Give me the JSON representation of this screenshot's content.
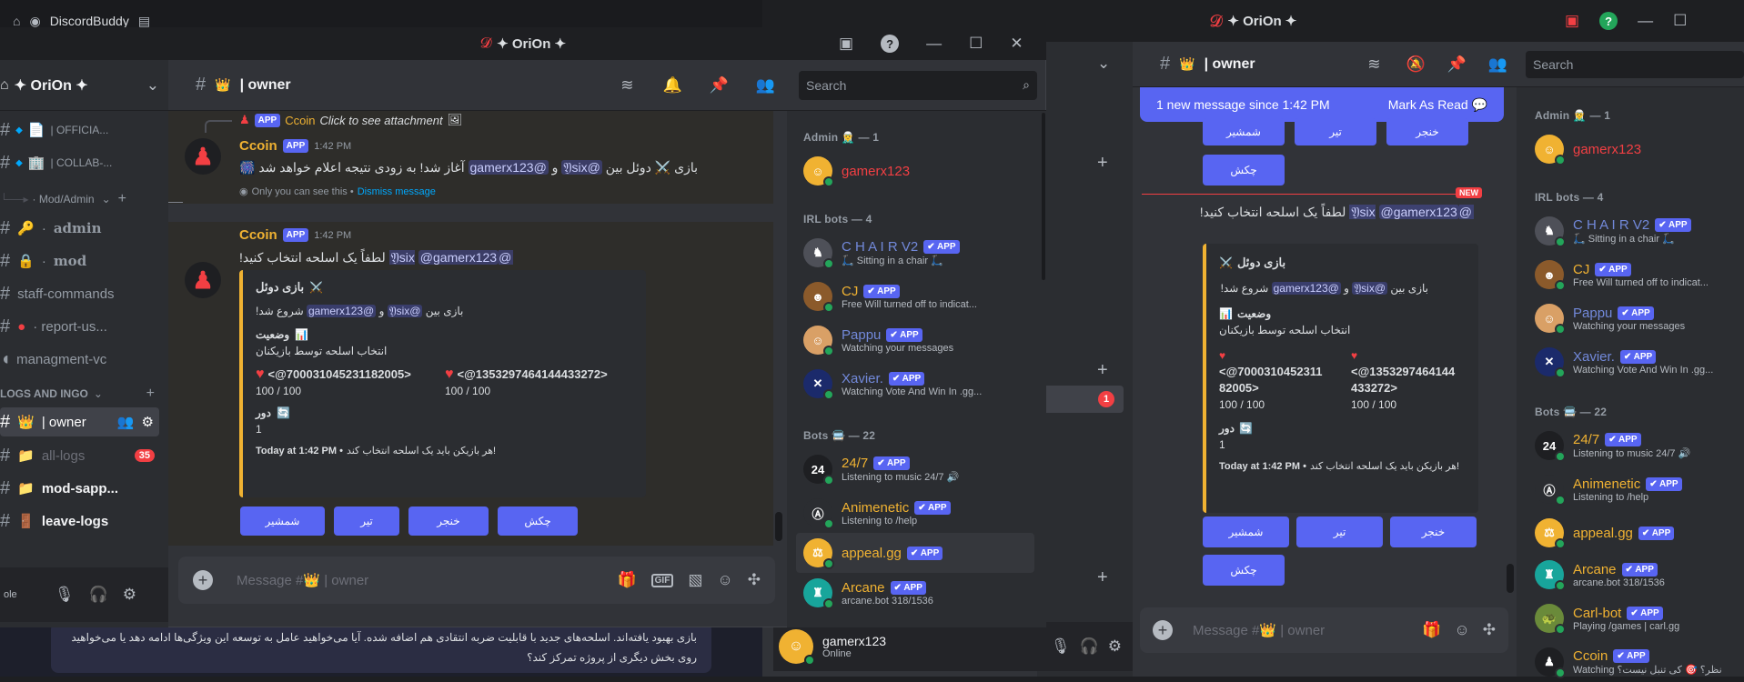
{
  "taskbar": {
    "app_name": "DiscordBuddy"
  },
  "main": {
    "title": "✦ OriOn ✦",
    "server_name": "✦ OriOn ✦",
    "channel_name": "| owner",
    "search_placeholder": "Search",
    "message_placeholder": "Message #",
    "message_placeholder_channel": "| owner",
    "channels": [
      {
        "label": "| OFFICIA..."
      },
      {
        "label": "| COLLAB-..."
      },
      {
        "label": "· Mod/Admin"
      },
      {
        "label": "admin"
      },
      {
        "label": "mod"
      },
      {
        "label": "staff-commands"
      },
      {
        "label": "· report-us..."
      },
      {
        "label": "managment-vc"
      },
      {
        "label": "LOGS AND INGO"
      },
      {
        "label": "| owner"
      },
      {
        "label": "all-logs",
        "badge": "35"
      },
      {
        "label": "mod-sapp..."
      },
      {
        "label": "leave-logs"
      }
    ],
    "user_status": "ole",
    "messages": {
      "reply_app": "APP",
      "reply_name": "Ccoin",
      "reply_text": "Click to see attachment",
      "m1_name": "Ccoin",
      "m1_badge": "APP",
      "m1_time": "1:42 PM",
      "m1_text_a": "بازی",
      "m1_text_b": "دوئل بین",
      "m1_mention_a": "@𝔜six",
      "m1_and": "و",
      "m1_mention_b": "@gamerx123",
      "m1_text_c": "آغاز شد! به زودی نتیجه اعلام خواهد شد",
      "m1_ephemeral": "Only you can see this •",
      "m1_dismiss": "Dismiss message",
      "m2_name": "Ccoin",
      "m2_badge": "APP",
      "m2_time": "1:42 PM",
      "m2_text": "لطفاً یک اسلحه انتخاب کنید!",
      "m2_mention_a": "@gamerx123",
      "m2_mention_b": "@𝔜six",
      "embed_title": "بازی دوئل",
      "embed_line1_a": "بازی بین",
      "embed_line1_b": "و",
      "embed_line1_c": "شروع شد!",
      "embed_mention_a": "@gamerx123",
      "embed_mention_b": "@𝔜six",
      "embed_status_title": "وضعیت",
      "embed_status_text": "انتخاب اسلحه توسط بازیکنان",
      "p1_id": "<@700031045231182005>",
      "p1_hp": "100 / 100",
      "p2_id": "<@1353297464144433272>",
      "p2_hp": "100 / 100",
      "round_title": "دور",
      "round_value": "1",
      "footer_time": "Today at 1:42 PM •",
      "footer_text": "هر بازیکن باید یک اسلحه انتخاب کند!"
    },
    "buttons": [
      "شمشیر",
      "تیر",
      "خنجر",
      "چکش"
    ],
    "members": {
      "admin_header": "Admin 🧝‍♂️ — 1",
      "irl_header": "IRL bots — 4",
      "bots_header": "Bots 🚍 — 22",
      "list": [
        {
          "name": "gamerx123",
          "sub": "",
          "color": "#f23f43",
          "group": "admin"
        },
        {
          "name": "C H A I R V2",
          "sub": "🛴 Sitting in a chair 🛴",
          "color": "#7289da",
          "group": "irl",
          "app": "APP"
        },
        {
          "name": "CJ",
          "sub": "Free Will turned off to indicat...",
          "color": "#f0b232",
          "group": "irl",
          "app": "APP"
        },
        {
          "name": "Pappu",
          "sub": "Watching your messages",
          "color": "#7289da",
          "group": "irl",
          "app": "APP"
        },
        {
          "name": "Xavier.",
          "sub": "Watching Vote And Win In .gg...",
          "color": "#7289da",
          "group": "irl",
          "app": "APP"
        },
        {
          "name": "24/7",
          "sub": "Listening to music 24/7 🔊",
          "color": "#f0b232",
          "group": "bots",
          "app": "APP"
        },
        {
          "name": "Animenetic",
          "sub": "Listening to /help",
          "color": "#f0b232",
          "group": "bots",
          "app": "APP"
        },
        {
          "name": "appeal.gg",
          "sub": "",
          "color": "#f0b232",
          "group": "bots",
          "app": "APP"
        },
        {
          "name": "Arcane",
          "sub": "arcane.bot 318/1536",
          "color": "#f0b232",
          "group": "bots",
          "app": "APP"
        }
      ]
    }
  },
  "back": {
    "title": "✦ OriOn ✦",
    "channel_name": "| owner",
    "search_placeholder": "Search",
    "new_msg_bar": "1 new message since 1:42 PM",
    "mark_as_read": "Mark As Read",
    "new_label": "NEW",
    "msg_text": "لطفاً یک اسلحه انتخاب کنید!",
    "msg_mention_a": "@gamerx123",
    "msg_mention_b": "@𝔜six",
    "embed_title": "بازی دوئل",
    "embed_line1_a": "بازی بین",
    "embed_line1_b": "و",
    "embed_line1_c": "شروع شد!",
    "embed_status_title": "وضعیت",
    "embed_status_text": "انتخاب اسلحه توسط بازیکنان",
    "p1_id_a": "<@7000310452311",
    "p1_id_b": "82005>",
    "p1_hp": "100 / 100",
    "p2_id_a": "<@1353297464144",
    "p2_id_b": "433272>",
    "p2_hp": "100 / 100",
    "round_title": "دور",
    "round_value": "1",
    "footer_time": "Today at 1:42 PM •",
    "footer_text": "هر بازیکن باید یک اسلحه انتخاب کند!",
    "buttons_top": [
      "شمشیر",
      "تیر",
      "خنجر",
      "چکش"
    ],
    "buttons": [
      "شمشیر",
      "تیر",
      "خنجر",
      "چکش"
    ],
    "message_placeholder": "Message #",
    "message_placeholder_channel": "| owner",
    "user_name": "gamerx123",
    "user_status": "Online",
    "unread_badge": "1",
    "members": {
      "admin_header": "Admin 🧝‍♂️ — 1",
      "irl_header": "IRL bots — 4",
      "bots_header": "Bots 🚍 — 22",
      "list": [
        {
          "name": "gamerx123",
          "sub": "",
          "color": "#f23f43"
        },
        {
          "name": "C H A I R V2",
          "sub": "🛴 Sitting in a chair 🛴",
          "color": "#7289da",
          "app": "APP"
        },
        {
          "name": "CJ",
          "sub": "Free Will turned off to indicat...",
          "color": "#f0b232",
          "app": "APP"
        },
        {
          "name": "Pappu",
          "sub": "Watching your messages",
          "color": "#7289da",
          "app": "APP"
        },
        {
          "name": "Xavier.",
          "sub": "Watching Vote And Win In .gg...",
          "color": "#7289da",
          "app": "APP"
        },
        {
          "name": "24/7",
          "sub": "Listening to music 24/7 🔊",
          "color": "#f0b232",
          "app": "APP"
        },
        {
          "name": "Animenetic",
          "sub": "Listening to /help",
          "color": "#f0b232",
          "app": "APP"
        },
        {
          "name": "appeal.gg",
          "sub": "",
          "color": "#f0b232",
          "app": "APP"
        },
        {
          "name": "Arcane",
          "sub": "arcane.bot 318/1536",
          "color": "#f0b232",
          "app": "APP"
        },
        {
          "name": "Carl-bot",
          "sub": "Playing /games | carl.gg",
          "color": "#f0b232",
          "app": "APP"
        },
        {
          "name": "Ccoin",
          "sub": "Watching نظر؟ 🎯 کی تنبل نیست؟",
          "color": "#f0b232",
          "app": "APP"
        }
      ]
    }
  },
  "bottom_popup": {
    "line1": "بازی بهبود یافته‌اند. اسلحه‌های جدید با قابلیت ضربه انتقادی هم اضافه شده. آیا می‌خواهید عامل به توسعه این ویژگی‌ها ادامه دهد یا می‌خواهید",
    "line2": "روی بخش دیگری از پروژه تمرکز کند؟"
  },
  "colors": {
    "accent": "#5865f2",
    "online": "#23a55a",
    "embed_border": "#f0b232",
    "mention": "#c9cdfb",
    "bot_name": "#f0b232",
    "admin": "#f23f43"
  },
  "icons": [
    "threads-icon",
    "bell-icon",
    "pin-icon",
    "members-icon",
    "search-icon",
    "gift-icon",
    "gif-icon",
    "sticker-icon",
    "emoji-icon",
    "apps-icon",
    "mic-icon",
    "headphones-icon",
    "gear-icon"
  ]
}
